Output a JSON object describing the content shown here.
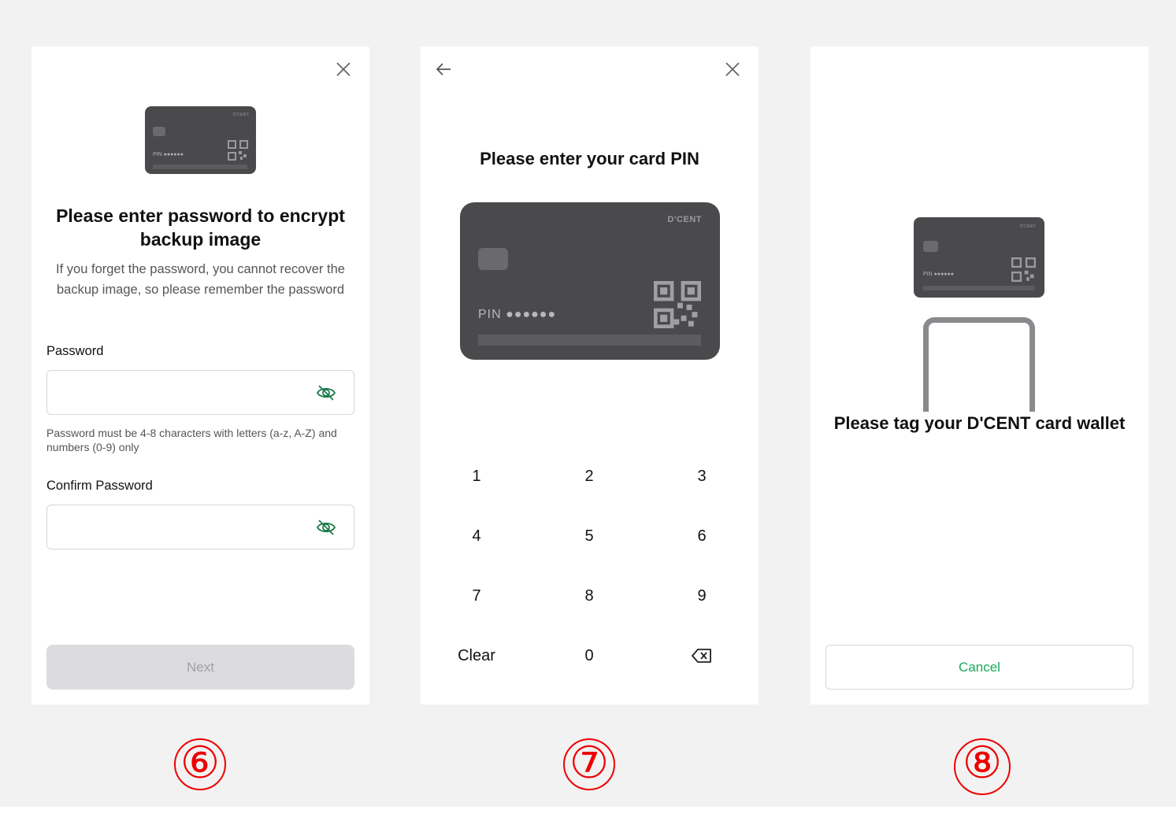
{
  "screen6": {
    "title": "Please enter password to encrypt backup image",
    "description": "If you forget the password, you cannot recover the backup image, so please remember the password",
    "password_label": "Password",
    "password_hint": "Password must be 4-8 characters with letters (a-z, A-Z) and numbers (0-9) only",
    "confirm_label": "Confirm Password",
    "next_label": "Next",
    "card": {
      "brand": "D'CENT",
      "pin_text": "PIN ●●●●●●"
    },
    "step_number": "⑥"
  },
  "screen7": {
    "title": "Please enter your card PIN",
    "card": {
      "brand": "D'CENT",
      "pin_text": "PIN ●●●●●●"
    },
    "keys": [
      "1",
      "2",
      "3",
      "4",
      "5",
      "6",
      "7",
      "8",
      "9",
      "Clear",
      "0"
    ],
    "step_number": "⑦"
  },
  "screen8": {
    "title": "Please tag your D'CENT card wallet",
    "cancel_label": "Cancel",
    "card": {
      "brand": "D'CENT",
      "pin_text": "PIN ●●●●●●"
    },
    "step_number": "⑧"
  },
  "colors": {
    "accent_green": "#1aa85a",
    "step_red": "#e00000",
    "card_gray": "#4a4a4c"
  },
  "icons": [
    "close-icon",
    "back-arrow-icon",
    "eye-off-icon",
    "backspace-icon",
    "qr-code-icon",
    "card-chip-icon"
  ]
}
